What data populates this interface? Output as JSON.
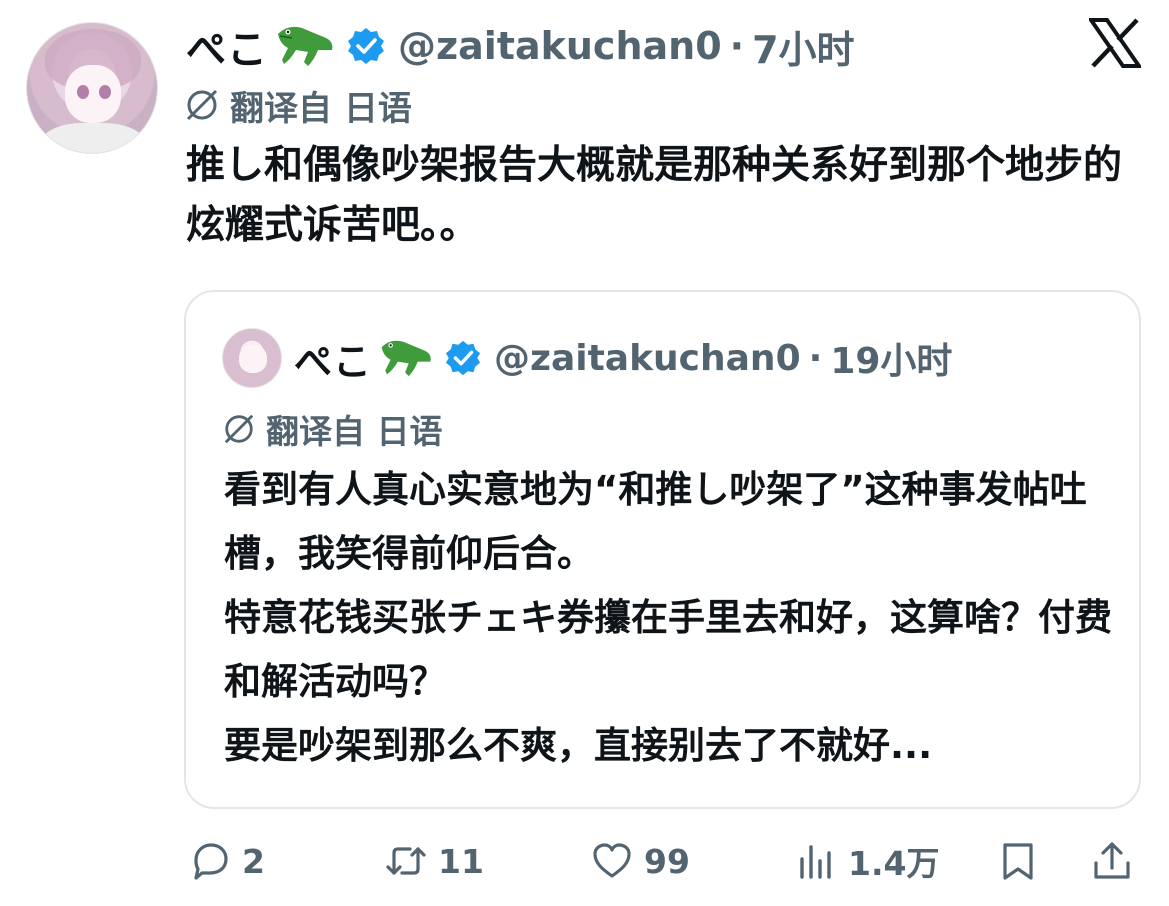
{
  "tweet": {
    "name": "ぺこ",
    "name_emoji": "crocodile",
    "handle": "@zaitakuchan0",
    "separator": "·",
    "time": "7小时",
    "translated_from": "翻译自 日语",
    "text": "推し和偶像吵架报告大概就是那种关系好到那个地步的炫耀式诉苦吧。。"
  },
  "quoted": {
    "name": "ぺこ",
    "name_emoji": "crocodile",
    "handle": "@zaitakuchan0",
    "separator": "·",
    "time": "19小时",
    "translated_from": "翻译自 日语",
    "lines": [
      "看到有人真心实意地为“和推し吵架了”这种事发帖吐槽，我笑得前仰后合。",
      "特意花钱买张チェキ券攥在手里去和好，这算啥？付费和解活动吗？",
      "要是吵架到那么不爽，直接别去了不就好..."
    ]
  },
  "actions": {
    "replies": "2",
    "retweets": "11",
    "likes": "99",
    "views": "1.4万"
  },
  "icons": {
    "verified": "verified-badge-icon",
    "translate": "translate-globe-icon",
    "close": "x-logo-icon",
    "reply": "reply-icon",
    "retweet": "retweet-icon",
    "like": "heart-icon",
    "views": "views-icon",
    "bookmark": "bookmark-icon",
    "share": "share-icon"
  },
  "colors": {
    "verified_blue": "#1d9bf0",
    "secondary_text": "#536471",
    "primary_text": "#0f1419",
    "border": "#e3e6e8"
  }
}
